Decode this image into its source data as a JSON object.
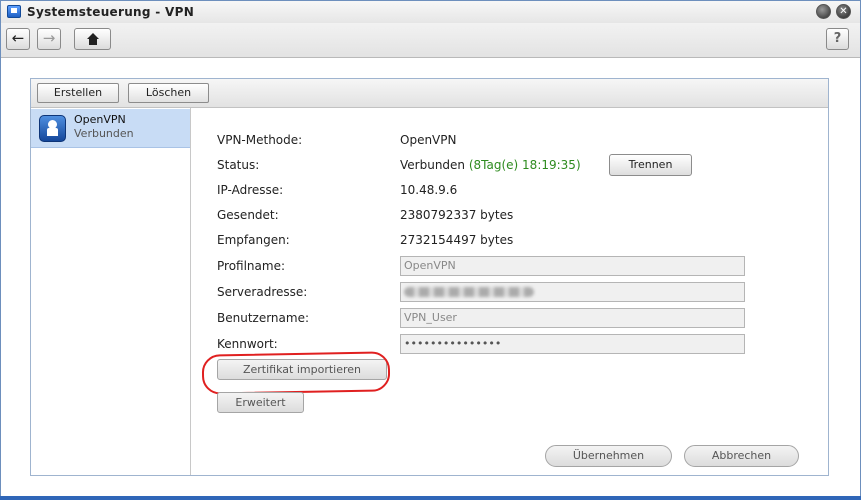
{
  "window": {
    "title": "Systemsteuerung - VPN",
    "help_label": "?"
  },
  "nav": {
    "back_glyph": "←",
    "forward_glyph": "→"
  },
  "toolbar": {
    "create_label": "Erstellen",
    "delete_label": "Löschen"
  },
  "profiles": [
    {
      "name": "OpenVPN",
      "status": "Verbunden",
      "icon": "vpn-user-icon"
    }
  ],
  "details": {
    "method_label": "VPN-Methode:",
    "method_value": "OpenVPN",
    "status_label": "Status:",
    "status_value": "Verbunden",
    "status_duration": "(8Tag(e) 18:19:35)",
    "disconnect_label": "Trennen",
    "ip_label": "IP-Adresse:",
    "ip_value": "10.48.9.6",
    "sent_label": "Gesendet:",
    "sent_value": "2380792337 bytes",
    "received_label": "Empfangen:",
    "received_value": "2732154497 bytes",
    "profile_label": "Profilname:",
    "profile_value": "OpenVPN",
    "server_label": "Serveradresse:",
    "user_label": "Benutzername:",
    "user_value": "VPN_User",
    "password_label": "Kennwort:",
    "password_value": "•••••••••••••••",
    "import_cert_label": "Zertifikat importieren",
    "advanced_label": "Erweitert",
    "apply_label": "Übernehmen",
    "cancel_label": "Abbrechen"
  },
  "colors": {
    "status_green": "#2e8b1f",
    "highlight_red": "#e02020",
    "selected_row": "#c8dcf5"
  }
}
